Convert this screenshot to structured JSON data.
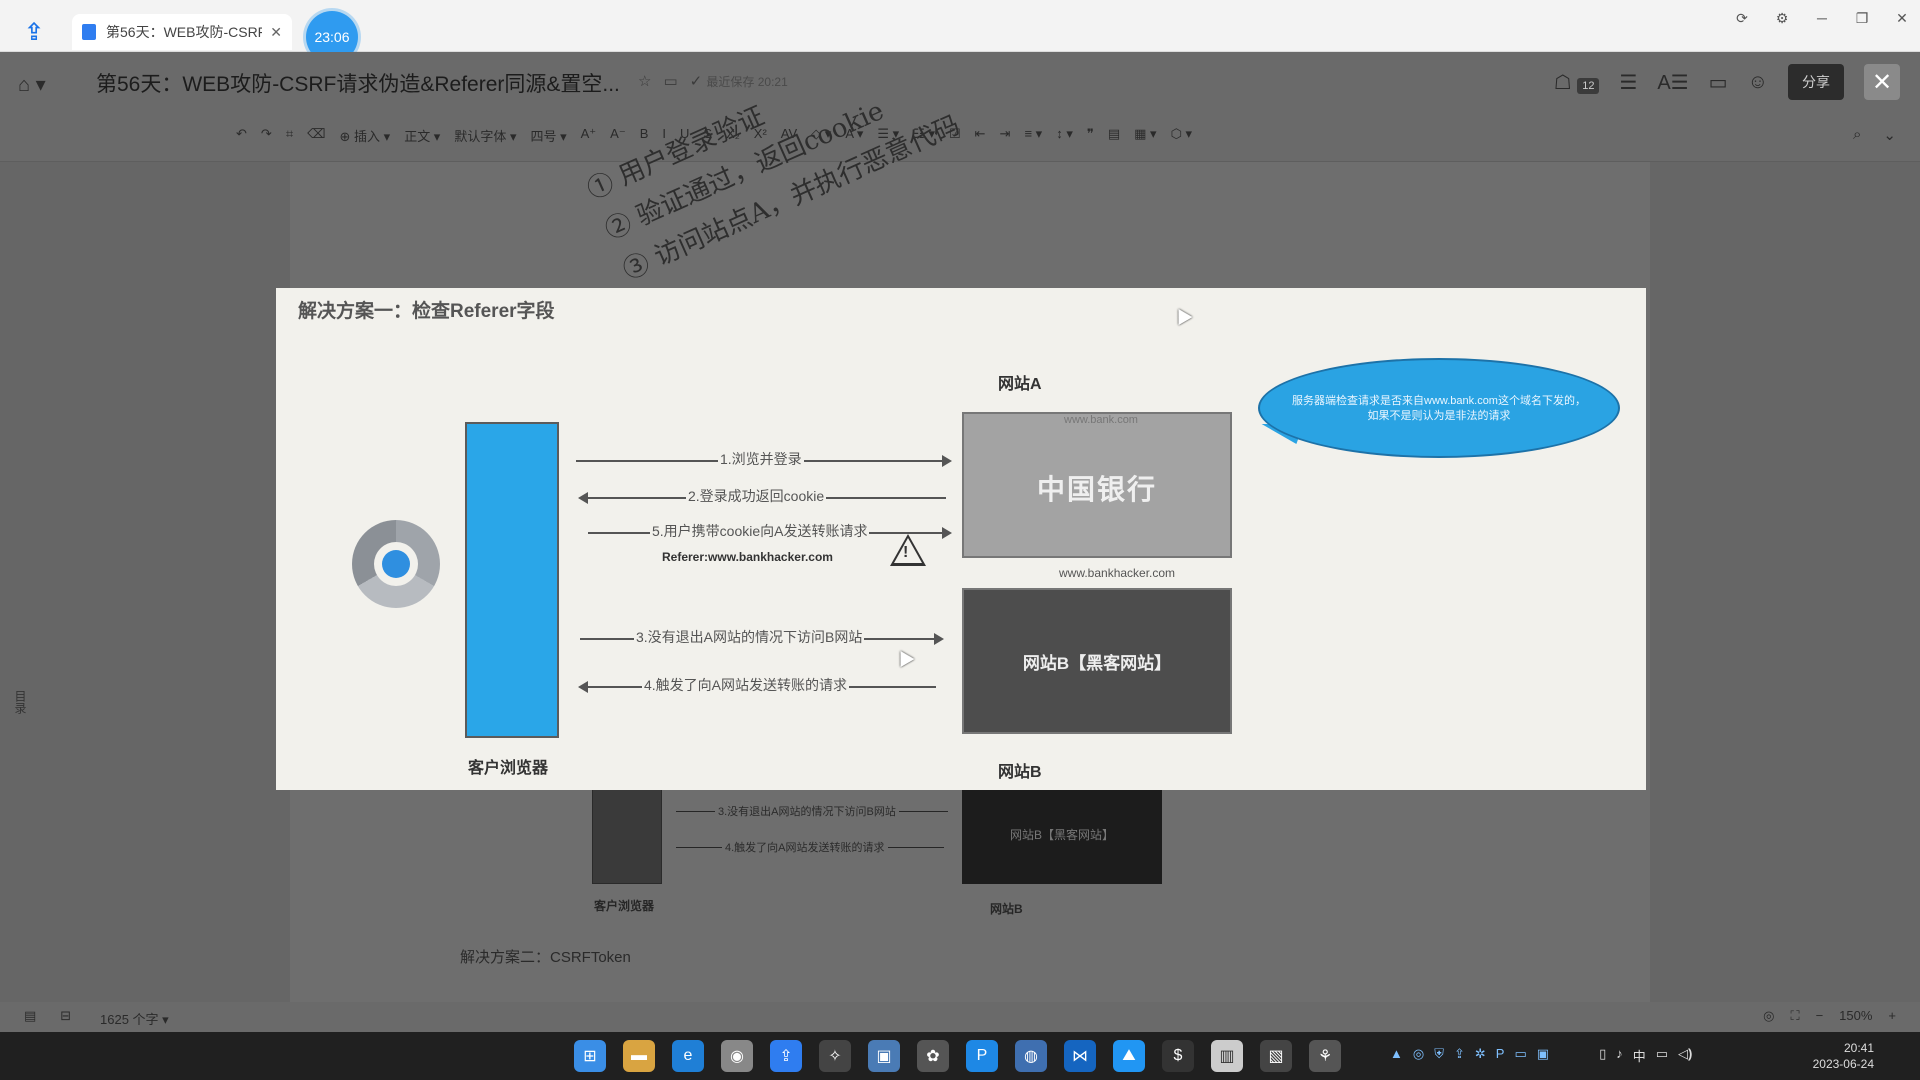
{
  "titlebar": {
    "tab_label": "第56天：WEB攻防-CSRF...",
    "timer": "23:06",
    "controls": [
      "⟳",
      "⚙",
      "─",
      "❐",
      "✕"
    ]
  },
  "header": {
    "title": "第56天：WEB攻防-CSRF请求伪造&Referer同源&置空...",
    "saved": "最近保存 20:21",
    "badge": "12",
    "share": "分享"
  },
  "toolbar": {
    "items": [
      "↶",
      "↷",
      "⌗",
      "⌫",
      "⊕ 插入 ▾",
      "正文 ▾",
      "默认字体 ▾",
      "四号 ▾",
      "A⁺",
      "A⁻",
      "B",
      "I",
      "U",
      "S",
      "X₂",
      "X²",
      "AV",
      "◇ ▾",
      "A ▾",
      "☰ ▾",
      "☷ ▾",
      "☑",
      "⇤",
      "⇥",
      "≡ ▾",
      "↕ ▾",
      "❞",
      "▤",
      "▦ ▾",
      "⬡ ▾"
    ]
  },
  "background": {
    "stamp_lines": [
      "① 用户登录验证",
      "② 验证通过，返回cookie",
      "③ 访问站点A，并执行恶意代码"
    ],
    "bg_arrow1": "3.没有退出A网站的情况下访问B网站",
    "bg_arrow2": "4.触发了向A网站发送转账的请求",
    "bg_siteb": "网站B【黑客网站】",
    "bg_client": "客户浏览器",
    "bg_siteb_label": "网站B",
    "solution2": "解决方案二：CSRFToken",
    "outline": "目录"
  },
  "viewer": {
    "title": "解决方案一：检查Referer字段",
    "client_label": "客户浏览器",
    "arrow1": "1.浏览并登录",
    "arrow2": "2.登录成功返回cookie",
    "arrow5": "5.用户携带cookie向A发送转账请求",
    "referer": "Referer:www.bankhacker.com",
    "arrow3": "3.没有退出A网站的情况下访问B网站",
    "arrow4": "4.触发了向A网站发送转账的请求",
    "site_a_label": "网站A",
    "site_a_url": "www.bank.com",
    "site_a_name": "中国银行",
    "site_a_url2": "www.bankhacker.com",
    "site_b_name": "网站B【黑客网站】",
    "site_b_label": "网站B",
    "bubble": "服务器端检查请求是否来自www.bank.com这个域名下发的，如果不是则认为是非法的请求"
  },
  "statusbar": {
    "word_count": "1625 个字 ▾",
    "zoom_minus": "−",
    "zoom": "150%",
    "zoom_plus": "+"
  },
  "taskbar": {
    "time": "20:41",
    "date": "2023-06-24",
    "ime": "中"
  },
  "colors": {
    "accent": "#2aa6e8",
    "timer": "#2f9bf0"
  }
}
